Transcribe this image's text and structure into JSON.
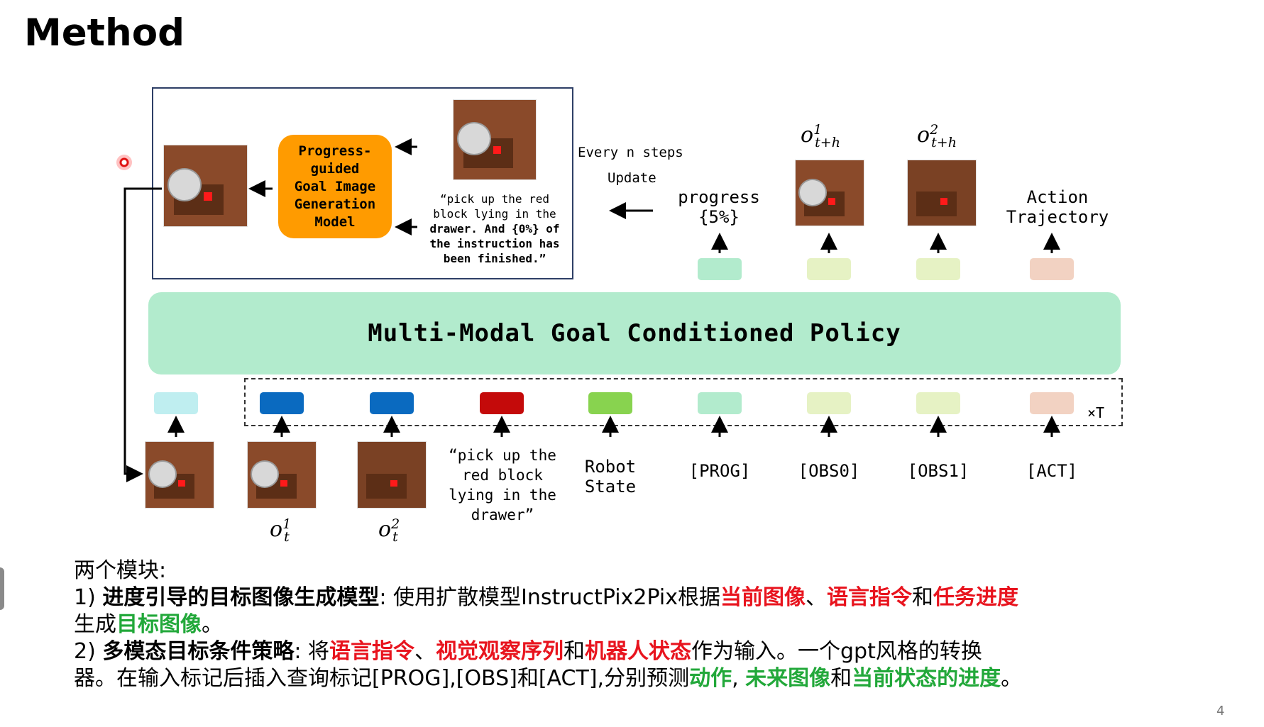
{
  "slide": {
    "title": "Method",
    "page_number": "4"
  },
  "diagram": {
    "goal_model_label": "Progress-guided Goal Image Generation Model",
    "goal_model_lines": [
      "Progress-",
      "guided",
      "Goal Image",
      "Generation",
      "Model"
    ],
    "instruction_progress_lines": [
      "“pick up the red",
      "block lying in the",
      "drawer. And {0%} of",
      "the instruction has",
      "been finished.”"
    ],
    "every_n_steps": "Every n steps",
    "update": "Update",
    "progress_label_lines": [
      "progress",
      "{5%}"
    ],
    "obs1_label": {
      "base": "o",
      "sup": "1",
      "sub": "t+h"
    },
    "obs2_label": {
      "base": "o",
      "sup": "2",
      "sub": "t+h"
    },
    "action_traj_lines": [
      "Action",
      "Trajectory"
    ],
    "policy_label": "Multi-Modal Goal Conditioned Policy",
    "times_t": "×T",
    "input_ot1": {
      "base": "o",
      "sup": "1",
      "sub": "t"
    },
    "input_ot2": {
      "base": "o",
      "sup": "2",
      "sub": "t"
    },
    "input_lang_lines": [
      "“pick up the",
      "red block",
      "lying in the",
      "drawer”"
    ],
    "robot_state_lines": [
      "Robot",
      "State"
    ],
    "prog_token": "[PROG]",
    "obs0_token": "[OBS0]",
    "obs1_token": "[OBS1]",
    "act_token": "[ACT]",
    "colors": {
      "orange": "#ff9b00",
      "policy": "#b2ebcd",
      "goal_token": "#bfeef0",
      "obs_token": "#0a6ac0",
      "lang_token": "#c40a0a",
      "state_token": "#88d34f",
      "prog_token": "#b2ebcd",
      "obs_out_token": "#e6f2c4",
      "act_token": "#f2d2c2"
    }
  },
  "text": {
    "heading": "两个模块:",
    "item1": {
      "num": "1)",
      "title": "进度引导的目标图像生成模型",
      "sep": ":",
      "plain1": "使用扩散模型InstructPix2Pix根据",
      "red1": "当前图像",
      "sep1": "、",
      "red2": "语言指令",
      "and1": "和",
      "red3": "任务进度",
      "plain2": "生成",
      "green1": "目标图像",
      "end": "。"
    },
    "item2": {
      "num": "2)",
      "title": "多模态目标条件策略",
      "sep": ":",
      "plain1": "将",
      "red1": "语言指令",
      "sep1": "、",
      "red2": "视觉观察序列",
      "and1": "和",
      "red3": "机器人状态",
      "plain2": "作为输入。一个gpt风格的转换",
      "plain3": "器。在输入标记后插入查询标记[PROG],[OBS]和[ACT],分别预测",
      "green1": "动作",
      "comma": ",",
      "green2": "未来图像",
      "and2": "和",
      "green3": "当前状态的进度",
      "end": "。"
    }
  }
}
